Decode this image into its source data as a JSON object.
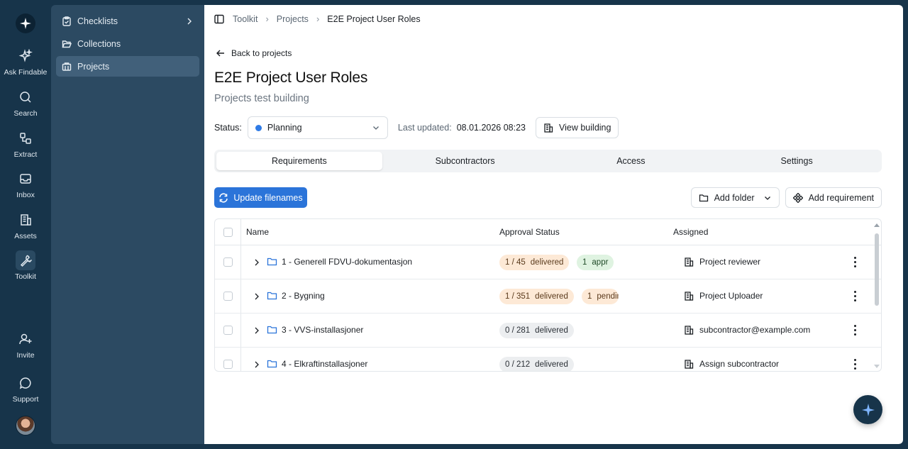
{
  "rail": {
    "items": [
      {
        "label": "Ask Findable",
        "icon": "sparkle-icon"
      },
      {
        "label": "Search",
        "icon": "search-icon"
      },
      {
        "label": "Extract",
        "icon": "extract-icon"
      },
      {
        "label": "Inbox",
        "icon": "inbox-icon"
      },
      {
        "label": "Assets",
        "icon": "building-icon"
      },
      {
        "label": "Toolkit",
        "icon": "wrench-icon"
      },
      {
        "label": "Invite",
        "icon": "user-plus-icon"
      },
      {
        "label": "Support",
        "icon": "chat-bubble-icon"
      }
    ]
  },
  "sidebar": {
    "items": [
      {
        "label": "Checklists",
        "icon": "clipboard-icon"
      },
      {
        "label": "Collections",
        "icon": "folder-open-icon"
      },
      {
        "label": "Projects",
        "icon": "projects-icon"
      }
    ]
  },
  "breadcrumb": {
    "items": [
      "Toolkit",
      "Projects"
    ],
    "current": "E2E Project User Roles"
  },
  "back_link": "Back to projects",
  "project": {
    "title": "E2E Project User Roles",
    "subtitle": "Projects test building"
  },
  "status": {
    "label": "Status:",
    "value": "Planning",
    "dot_color": "#2f7be6",
    "last_updated_label": "Last updated:",
    "last_updated_value": "08.01.2026 08:23",
    "view_building": "View building"
  },
  "tabs": [
    "Requirements",
    "Subcontractors",
    "Access",
    "Settings"
  ],
  "toolbar": {
    "update_filenames": "Update filenames",
    "add_folder": "Add folder",
    "add_requirement": "Add requirement",
    "primary_color": "#2b74d9"
  },
  "table": {
    "headers": {
      "name": "Name",
      "approval": "Approval Status",
      "assigned": "Assigned"
    },
    "rows": [
      {
        "name": "1 - Generell FDVU-dokumentasjon",
        "count": "1 / 45",
        "delivered": "delivered",
        "extra_n": "1",
        "extra_text": "appr",
        "extra_style": "green",
        "assigned": "Project reviewer"
      },
      {
        "name": "2 - Bygning",
        "count": "1 / 351",
        "delivered": "delivered",
        "extra_n": "1",
        "extra_text": "pending",
        "extra_style": "peach",
        "assigned": "Project Uploader"
      },
      {
        "name": "3 - VVS-installasjoner",
        "count": "0 / 281",
        "delivered": "delivered",
        "extra_n": "",
        "extra_text": "",
        "extra_style": "",
        "assigned": "subcontractor@example.com"
      },
      {
        "name": "4 - Elkraftinstallasjoner",
        "count": "0 / 212",
        "delivered": "delivered",
        "extra_n": "",
        "extra_text": "",
        "extra_style": "",
        "assigned": "Assign subcontractor"
      }
    ]
  }
}
